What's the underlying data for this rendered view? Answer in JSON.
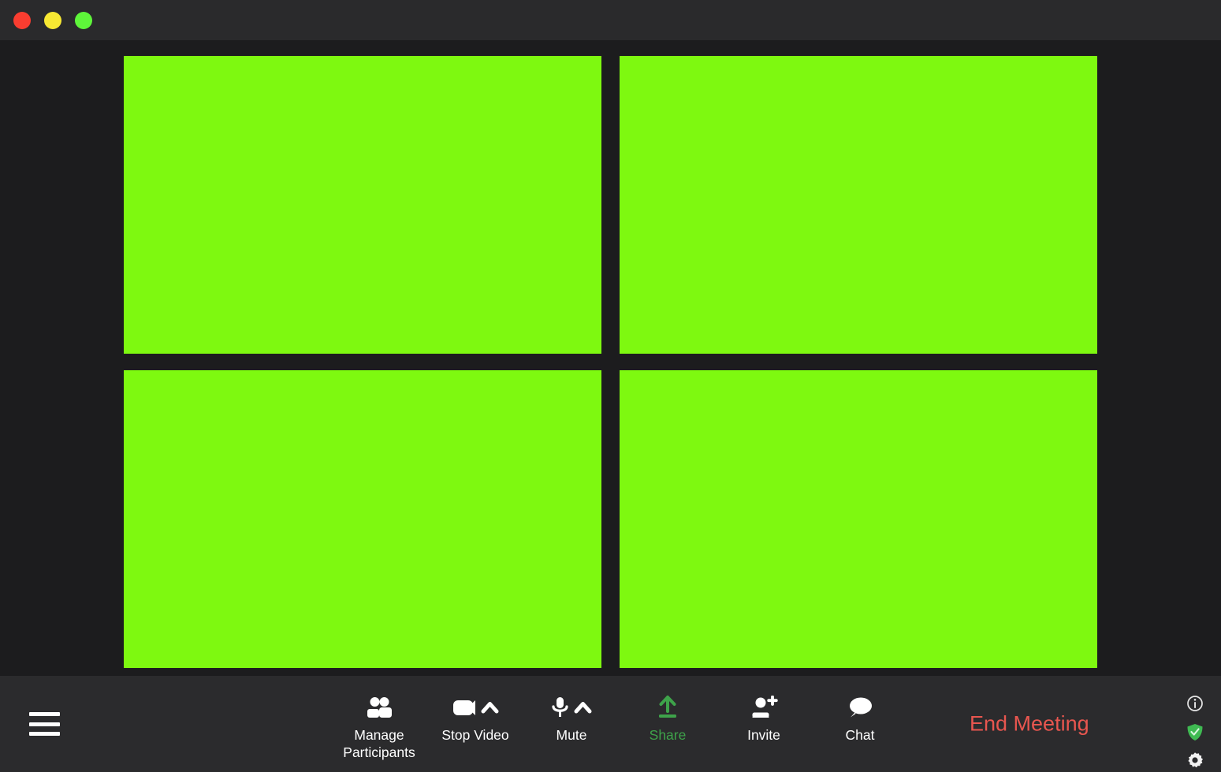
{
  "window": {
    "controls": [
      {
        "name": "close",
        "color": "#f93d30"
      },
      {
        "name": "minimize",
        "color": "#f7e833"
      },
      {
        "name": "maximize",
        "color": "#5ef53a"
      }
    ]
  },
  "stage": {
    "tile_color": "#7ef910",
    "background": "#1c1c1e",
    "participants": [
      {
        "id": "tile-1"
      },
      {
        "id": "tile-2"
      },
      {
        "id": "tile-3"
      },
      {
        "id": "tile-4"
      }
    ]
  },
  "toolbar": {
    "background": "#2b2b2d",
    "menu_icon": "hamburger-menu-icon",
    "buttons": [
      {
        "label": "Manage\nParticipants",
        "icon": "participants-icon",
        "color": "#ffffff",
        "has_chevron": false
      },
      {
        "label": "Stop Video",
        "icon": "video-camera-icon",
        "color": "#ffffff",
        "has_chevron": true
      },
      {
        "label": "Mute",
        "icon": "microphone-icon",
        "color": "#ffffff",
        "has_chevron": true
      },
      {
        "label": "Share",
        "icon": "share-arrow-up-icon",
        "color": "#3ea34a",
        "has_chevron": false
      },
      {
        "label": "Invite",
        "icon": "add-person-icon",
        "color": "#ffffff",
        "has_chevron": false
      },
      {
        "label": "Chat",
        "icon": "chat-bubble-icon",
        "color": "#ffffff",
        "has_chevron": false
      }
    ],
    "end_meeting": {
      "label": "End Meeting",
      "color": "#e8564f"
    },
    "status_icons": [
      {
        "name": "info-icon",
        "color": "#ffffff"
      },
      {
        "name": "shield-check-icon",
        "color": "#3fba52"
      },
      {
        "name": "settings-gear-icon",
        "color": "#ffffff"
      }
    ]
  }
}
